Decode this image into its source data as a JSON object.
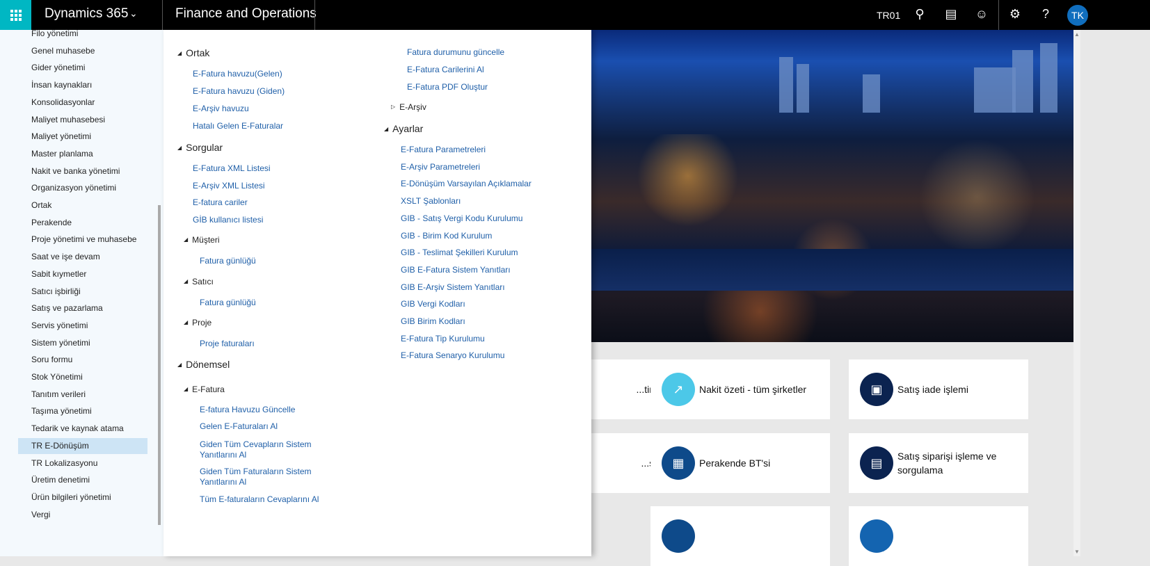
{
  "header": {
    "brand": "Dynamics 365",
    "app": "Finance and Operations",
    "company": "TR01",
    "avatar": "TK",
    "icons": [
      "waffle-icon",
      "chevron-down-icon",
      "search-icon",
      "message-icon",
      "smiley-icon",
      "gear-icon",
      "help-icon"
    ]
  },
  "sidebar": {
    "items": [
      "Filo yönetimi",
      "Genel muhasebe",
      "Gider yönetimi",
      "İnsan kaynakları",
      "Konsolidasyonlar",
      "Maliyet muhasebesi",
      "Maliyet yönetimi",
      "Master planlama",
      "Nakit ve banka yönetimi",
      "Organizasyon yönetimi",
      "Ortak",
      "Perakende",
      "Proje yönetimi ve muhasebe",
      "Saat ve işe devam",
      "Sabit kıymetler",
      "Satıcı işbirliği",
      "Satış ve pazarlama",
      "Servis yönetimi",
      "Sistem yönetimi",
      "Soru formu",
      "Stok Yönetimi",
      "Tanıtım verileri",
      "Taşıma yönetimi",
      "Tedarik ve kaynak atama",
      "TR E-Dönüşüm",
      "TR Lokalizasyonu",
      "Üretim denetimi",
      "Ürün bilgileri yönetimi",
      "Vergi"
    ],
    "selected": "TR E-Dönüşüm"
  },
  "menu": {
    "ortak": {
      "title": "Ortak",
      "links": [
        "E-Fatura havuzu(Gelen)",
        "E-Fatura havuzu (Giden)",
        "E-Arşiv havuzu",
        "Hatalı Gelen E-Faturalar"
      ]
    },
    "sorgular": {
      "title": "Sorgular",
      "links": [
        "E-Fatura XML Listesi",
        "E-Arşiv XML Listesi",
        "E-fatura cariler",
        "GİB kullanıcı listesi"
      ],
      "musteri": {
        "title": "Müşteri",
        "links": [
          "Fatura günlüğü"
        ]
      },
      "satici": {
        "title": "Satıcı",
        "links": [
          "Fatura günlüğü"
        ]
      },
      "proje": {
        "title": "Proje",
        "links": [
          "Proje faturaları"
        ]
      }
    },
    "donemsel": {
      "title": "Dönemsel",
      "efatura": {
        "title": "E-Fatura",
        "links": [
          "E-fatura Havuzu Güncelle",
          "Gelen E-Faturaları Al",
          "Giden Tüm Cevapların Sistem Yanıtlarını Al",
          "Giden Tüm Faturaların Sistem Yanıtlarını Al",
          "Tüm E-faturaların Cevaplarını Al",
          "Fatura durumunu güncelle",
          "E-Fatura Carilerini Al",
          "E-Fatura PDF Oluştur"
        ]
      },
      "earsiv": {
        "title": "E-Arşiv"
      }
    },
    "ayarlar": {
      "title": "Ayarlar",
      "links": [
        "E-Fatura Parametreleri",
        "E-Arşiv Parametreleri",
        "E-Dönüşüm Varsayılan Açıklamalar",
        "XSLT Şablonları",
        "GIB - Satış Vergi Kodu Kurulumu",
        "GIB - Birim Kod Kurulum",
        "GIB - Teslimat Şekilleri Kurulum",
        "GIB E-Fatura Sistem Yanıtları",
        "GIB E-Arşiv Sistem Yanıtları",
        "GIB Vergi Kodları",
        "GIB Birim Kodları",
        "E-Fatura Tip Kurulumu",
        "E-Fatura Senaryo Kurulumu"
      ]
    }
  },
  "tiles": [
    {
      "label": "...timi",
      "icon": "none",
      "color": "#ffffff"
    },
    {
      "label": "Nakit özeti - tüm şirketler",
      "icon": "trend-check-icon",
      "color": "#4cc8e8"
    },
    {
      "label": "Satış iade işlemi",
      "icon": "package-return-icon",
      "color": "#0b2350"
    },
    {
      "label": "...sü",
      "icon": "none",
      "color": "#ffffff"
    },
    {
      "label": "Perakende BT'si",
      "icon": "store-shield-icon",
      "color": "#0e4a8a"
    },
    {
      "label": "Satış siparişi işleme ve sorgulama",
      "icon": "document-refresh-icon",
      "color": "#0b2350"
    }
  ]
}
